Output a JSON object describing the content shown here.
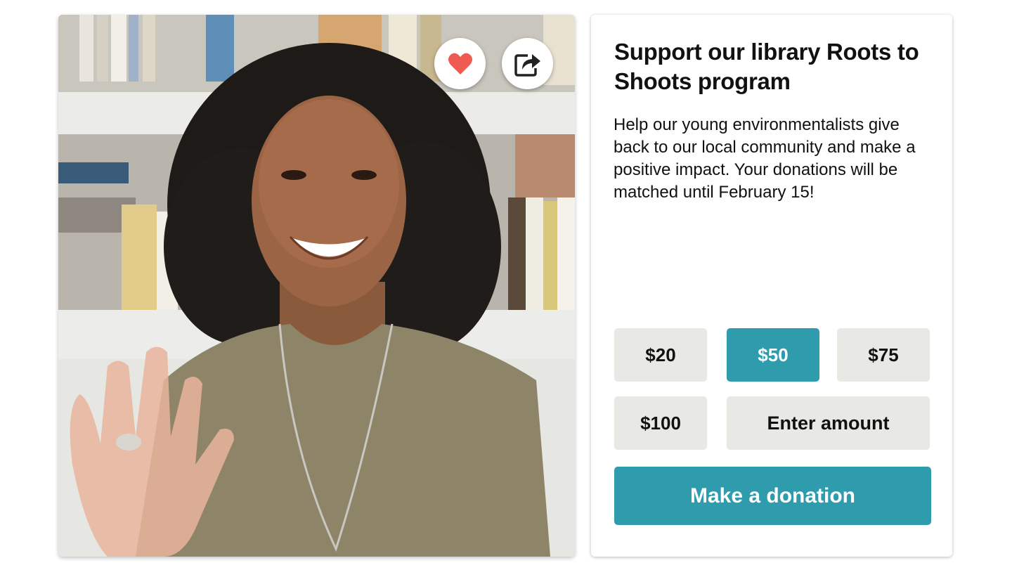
{
  "photo": {
    "alt_subject": "smiling woman waving"
  },
  "actions": {
    "like_icon": "heart-icon",
    "share_icon": "share-icon"
  },
  "campaign": {
    "title": "Support our library Roots to Shoots program",
    "description": "Help our young environmentalists give back to our local community and make a positive impact. Your donations will be matched until February 15!"
  },
  "amounts": {
    "option_20": "$20",
    "option_50": "$50",
    "option_75": "$75",
    "option_100": "$100",
    "custom": "Enter amount",
    "selected": "$50"
  },
  "donate": {
    "label": "Make a donation"
  },
  "colors": {
    "accent": "#2f9cae",
    "heart": "#ef5b52",
    "button_bg": "#e8e8e4"
  }
}
